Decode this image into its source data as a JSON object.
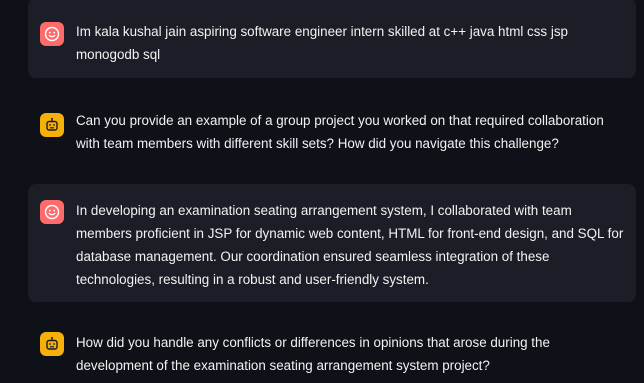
{
  "chat": {
    "messages": [
      {
        "role": "user",
        "avatar_icon": "smiley-face-icon",
        "text": "Im kala kushal jain aspiring software engineer intern skilled at c++ java html css jsp monogodb sql"
      },
      {
        "role": "assistant",
        "avatar_icon": "robot-face-icon",
        "text": "Can you provide an example of a group project you worked on that required collaboration with team members with different skill sets? How did you navigate this challenge?"
      },
      {
        "role": "user",
        "avatar_icon": "smiley-face-icon",
        "text": "In developing an examination seating arrangement system, I collaborated with team members proficient in JSP for dynamic web content, HTML for front-end design, and SQL for database management. Our coordination ensured seamless integration of these technologies, resulting in a robust and user-friendly system."
      },
      {
        "role": "assistant",
        "avatar_icon": "robot-face-icon",
        "text": "How did you handle any conflicts or differences in opinions that arose during the development of the examination seating arrangement system project?"
      }
    ]
  },
  "colors": {
    "background": "#0e1117",
    "user_bubble": "#1b1e26",
    "user_avatar": "#ff6b6b",
    "assistant_avatar": "#f5b10a",
    "text": "#f2f2f2"
  }
}
